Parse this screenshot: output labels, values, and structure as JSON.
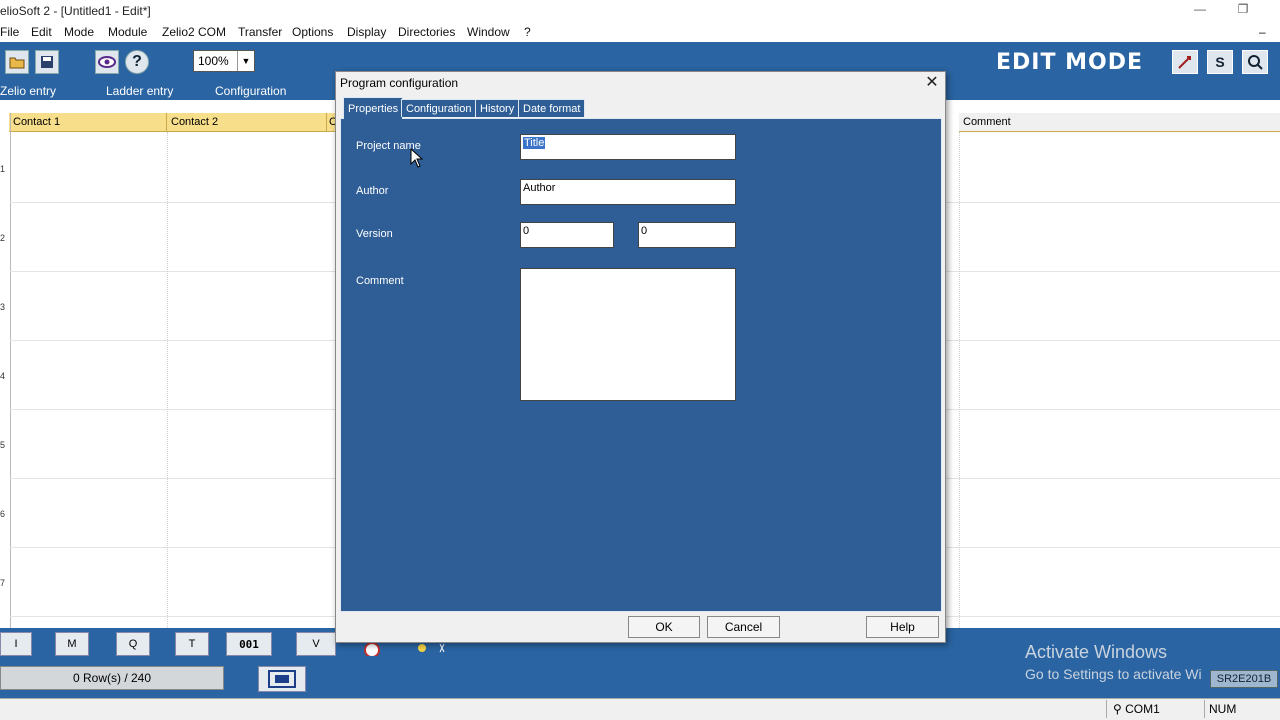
{
  "window": {
    "title": "elioSoft 2 - [Untitled1 - Edit*]",
    "minimize": "—",
    "restore": "❐",
    "doc_minimize": "–"
  },
  "menu": [
    "File",
    "Edit",
    "Mode",
    "Module",
    "Zelio2 COM",
    "Transfer",
    "Options",
    "Display",
    "Directories",
    "Window",
    "?"
  ],
  "toolbar": {
    "zoom": "100%",
    "mode_label": "EDIT MODE",
    "s_label": "S"
  },
  "nav_tabs": [
    "Zelio entry",
    "Ladder entry",
    "Configuration"
  ],
  "grid": {
    "columns": [
      "Contact 1",
      "Contact 2",
      "C",
      "Comment"
    ],
    "rows": [
      "1",
      "2",
      "3",
      "4",
      "5",
      "6",
      "7"
    ]
  },
  "bottom": {
    "tools": [
      "I",
      "M",
      "Q",
      "T",
      "001",
      "V"
    ],
    "rows_count": "0 Row(s) / 240",
    "module": "SR2E201B",
    "com": "COM1",
    "num": "NUM",
    "activate_title": "Activate Windows",
    "activate_sub": "Go to Settings to activate Wi"
  },
  "dialog": {
    "title": "Program configuration",
    "close": "✕",
    "tabs": [
      "Properties",
      "Configuration",
      "History",
      "Date format"
    ],
    "fields": {
      "project_name": {
        "label": "Project name",
        "value": "Title"
      },
      "author": {
        "label": "Author",
        "value": "Author"
      },
      "version": {
        "label": "Version",
        "major": "0",
        "minor": "0"
      },
      "comment": {
        "label": "Comment",
        "value": ""
      }
    },
    "buttons": {
      "ok": "OK",
      "cancel": "Cancel",
      "help": "Help"
    }
  },
  "colors": {
    "app_blue": "#2a64a2",
    "dialog_blue": "#2f5e96",
    "header_yellow": "#f6de8a"
  }
}
